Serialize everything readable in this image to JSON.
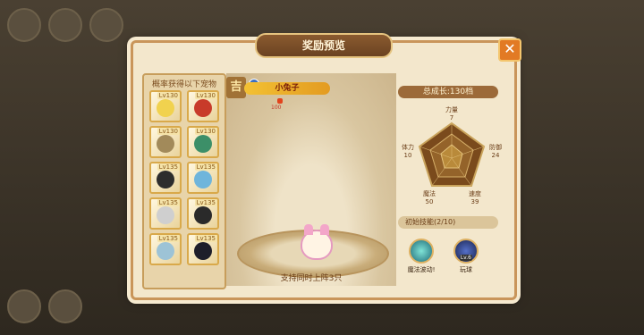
{
  "dialog": {
    "title": "奖励预览",
    "close_icon": "close-x-icon",
    "left_panel_title": "概率获得以下宠物",
    "pets": [
      {
        "level": "Lv130",
        "color": "#f1d24e"
      },
      {
        "level": "Lv130",
        "color": "#c83b2a"
      },
      {
        "level": "Lv130",
        "color": "#a28a5a"
      },
      {
        "level": "Lv130",
        "color": "#3c8f68"
      },
      {
        "level": "Lv135",
        "color": "#2d2d2d"
      },
      {
        "level": "Lv135",
        "color": "#6fb5db"
      },
      {
        "level": "Lv135",
        "color": "#cfcfcf"
      },
      {
        "level": "Lv135",
        "color": "#2a2a2a"
      },
      {
        "level": "Lv135",
        "color": "#9dc3d6"
      },
      {
        "level": "Lv135",
        "color": "#1e1e2a"
      }
    ],
    "pet_name": "小兔子",
    "seal_icon_text": "吉",
    "element_value": "100",
    "stage_footer": "支持同时上阵3只",
    "growth_label": "总成长:130档",
    "stats": {
      "power_label": "力量",
      "power_value": "7",
      "stamina_label": "体力",
      "stamina_value": "10",
      "defense_label": "防御",
      "defense_value": "24",
      "magic_label": "魔法",
      "magic_value": "50",
      "speed_label": "速度",
      "speed_value": "39"
    },
    "skills_label": "初始技能(2/10)",
    "skills": [
      {
        "name": "魔法波动!",
        "icon": "magic-wave-icon",
        "level_tag": ""
      },
      {
        "name": "玩球",
        "icon": "play-ball-icon",
        "level_tag": "Lv.6"
      }
    ]
  }
}
